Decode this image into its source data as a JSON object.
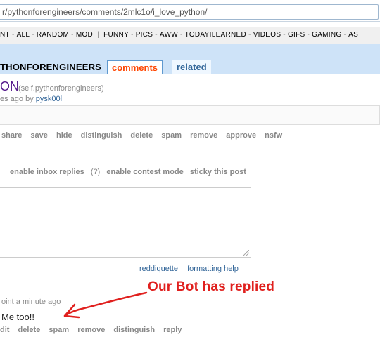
{
  "browser": {
    "url": "r/pythonforengineers/comments/2mlc1o/i_love_python/"
  },
  "srbar": {
    "items": [
      "NT",
      "ALL",
      "RANDOM",
      "MOD",
      "FUNNY",
      "PICS",
      "AWW",
      "TODAYILEARNED",
      "VIDEOS",
      "GIFS",
      "GAMING",
      "AS"
    ]
  },
  "header": {
    "subreddit": "THONFORENGINEERS",
    "tabs": {
      "comments": "comments",
      "related": "related"
    }
  },
  "post": {
    "title": "ON",
    "domain": "(self.pythonforengineers)",
    "tagline_prefix": "es ago by",
    "author": "pysk00l",
    "buttons": [
      "share",
      "save",
      "hide",
      "distinguish",
      "delete",
      "spam",
      "remove",
      "approve",
      "nsfw"
    ]
  },
  "options": {
    "inbox": "enable inbox replies",
    "help": "(?)",
    "contest": "enable contest mode",
    "sticky": "sticky this post"
  },
  "editor": {
    "links": [
      "reddiquette",
      "formatting help"
    ]
  },
  "comment": {
    "tagline": "oint a minute ago",
    "body": "Me too!!",
    "buttons": [
      "dit",
      "delete",
      "spam",
      "remove",
      "distinguish",
      "reply"
    ]
  },
  "annotation": {
    "text": "Our Bot has replied",
    "color": "#e0201e"
  }
}
